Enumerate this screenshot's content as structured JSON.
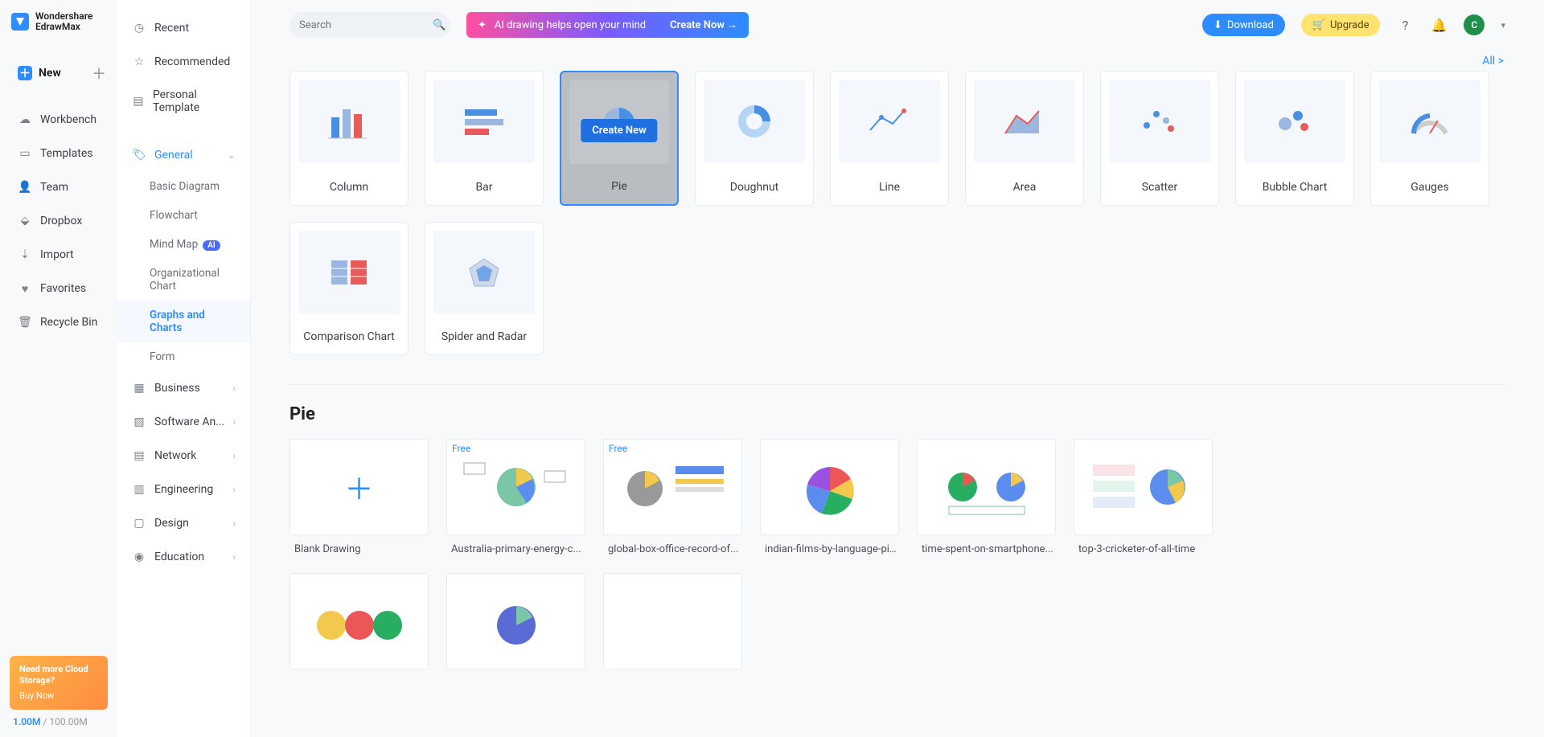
{
  "app": {
    "name_line1": "Wondershare",
    "name_line2": "EdrawMax"
  },
  "nav1": {
    "new": "New",
    "items": [
      "Workbench",
      "Templates",
      "Team",
      "Dropbox",
      "Import",
      "Favorites",
      "Recycle Bin"
    ]
  },
  "promo": {
    "line1": "Need more Cloud",
    "line2": "Storage?",
    "cta": "Buy Now"
  },
  "storage": {
    "used": "1.00M",
    "total": "100.00M",
    "sep": " / "
  },
  "nav2_top": [
    "Recent",
    "Recommended",
    "Personal Template"
  ],
  "nav2_general": {
    "label": "General",
    "subs": [
      "Basic Diagram",
      "Flowchart",
      "Mind Map",
      "Organizational Chart",
      "Graphs and Charts",
      "Form"
    ],
    "ai_badge": "AI",
    "selected": "Graphs and Charts"
  },
  "nav2_bottom": [
    "Business",
    "Software An...",
    "Network",
    "Engineering",
    "Design",
    "Education"
  ],
  "search_placeholder": "Search",
  "banner": {
    "text": "AI drawing helps open your mind",
    "cta": "Create Now  →"
  },
  "top_buttons": {
    "download": "Download",
    "upgrade": "Upgrade"
  },
  "avatar_initial": "C",
  "all_link": "All  >",
  "chart_types": [
    "Column",
    "Bar",
    "Pie",
    "Doughnut",
    "Line",
    "Area",
    "Scatter",
    "Bubble Chart",
    "Gauges",
    "Comparison Chart",
    "Spider and Radar"
  ],
  "selected_chart": "Pie",
  "create_new": "Create New",
  "section_title": "Pie",
  "templates": [
    {
      "label": "Blank Drawing",
      "blank": true
    },
    {
      "label": "Australia-primary-energy-c...",
      "free": true
    },
    {
      "label": "global-box-office-record-of...",
      "free": true
    },
    {
      "label": "indian-films-by-language-pi..."
    },
    {
      "label": "time-spent-on-smartphone..."
    },
    {
      "label": "top-3-cricketer-of-all-time"
    }
  ],
  "free_text": "Free"
}
